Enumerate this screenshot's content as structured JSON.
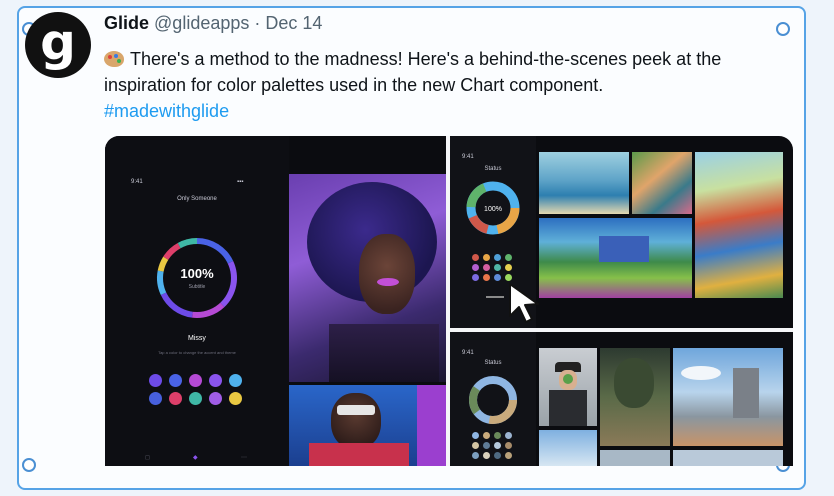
{
  "tweet": {
    "avatar_letter": "g",
    "display_name": "Glide",
    "handle": "@glideapps",
    "separator": "·",
    "date": "Dec 14",
    "emoji": "palette-emoji",
    "text": "There's a method to the madness! Here's a behind-the-scenes peek at the inspiration for color palettes used in the new Chart component.",
    "hashtag": "#madewithglide"
  },
  "media": {
    "phone": {
      "title": "Only Someone",
      "donut_value": "100%",
      "donut_sub": "Subtitle",
      "artist": "Missy",
      "caption": "Tap a color to change the accent and theme",
      "swatches": [
        "#6d4be8",
        "#4a63e6",
        "#b54ad4",
        "#8a54ee",
        "#4fb2ee",
        "#4760dd",
        "#dd3f6a",
        "#3fb8a6",
        "#a05de6",
        "#e9c842"
      ]
    },
    "mini_phones": [
      {
        "label": "Status",
        "donut_value": "100%",
        "dots": [
          "#d0584a",
          "#e8a547",
          "#4fa0d8",
          "#5fb36b",
          "#b35fd0",
          "#d45fa0",
          "#4fb6a6",
          "#e4d04f",
          "#7c6be0",
          "#e8754a",
          "#5e8bd8",
          "#9ad85e"
        ]
      },
      {
        "label": "Status",
        "donut_value": "",
        "dots": [
          "#8fb6e3",
          "#c9aa7c",
          "#6a8a5a",
          "#9bb3d0",
          "#d3c4a3",
          "#5f7b96",
          "#b6c9dc",
          "#a88c6a",
          "#7c9fbf",
          "#d8d0bb",
          "#4e6a82",
          "#b9a17a"
        ]
      }
    ],
    "colors": {
      "accent": "#1d9bf0",
      "frame": "#56a3e6",
      "donut": [
        "#4a63e6",
        "#8a54ee",
        "#b54ad4",
        "#6d4be8",
        "#4fb2ee",
        "#e9c842",
        "#dd3f6a",
        "#3fb8a6"
      ]
    }
  }
}
